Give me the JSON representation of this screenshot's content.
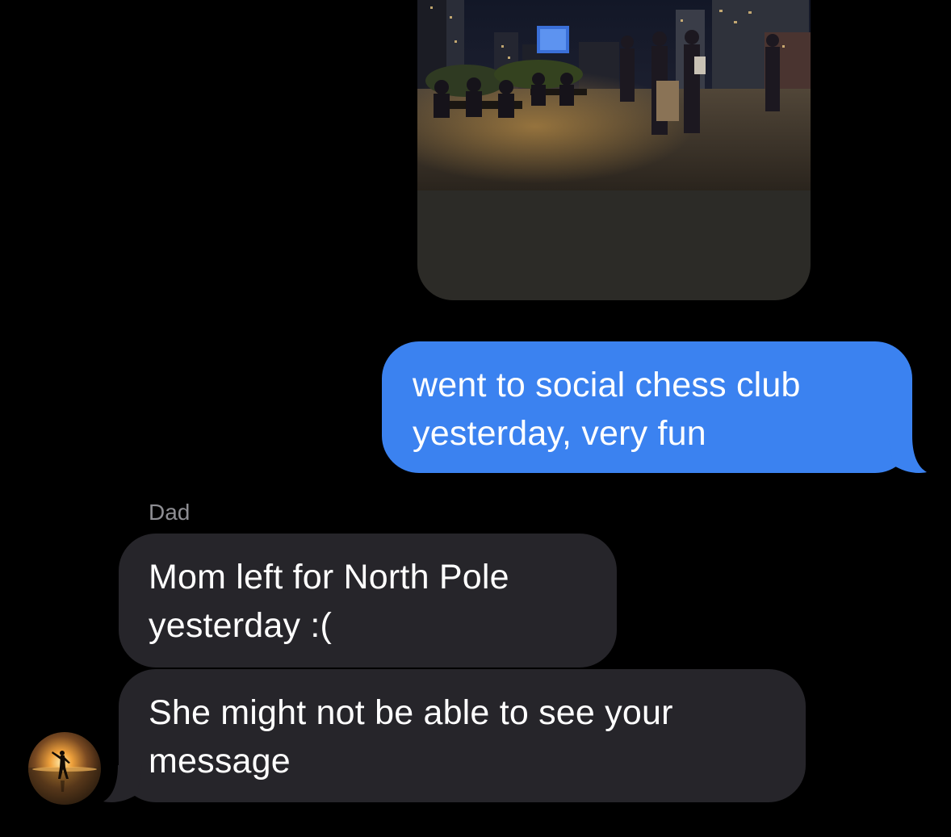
{
  "conversation": {
    "media": {
      "kind": "photo",
      "subject": "rooftop-chess-social"
    },
    "sent_message": {
      "text": "went to social chess club\nyesterday, very fun",
      "color": "#3b82f0"
    },
    "received": {
      "sender_name": "Dad",
      "bubble_color": "#26252a",
      "messages": [
        {
          "text": "Mom left for North Pole\nyesterday :("
        },
        {
          "text": "She might not be able to see your\nmessage"
        }
      ]
    },
    "avatar_icon": "sunset-silhouette-avatar"
  },
  "colors": {
    "background": "#000000",
    "sender_name": "#8e8e93",
    "text": "#ffffff"
  }
}
